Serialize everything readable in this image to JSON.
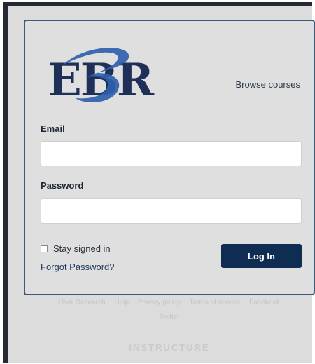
{
  "header": {
    "logo_text": "EBR",
    "browse_label": "Browse courses"
  },
  "form": {
    "email_label": "Email",
    "email_value": "",
    "password_label": "Password",
    "password_value": "",
    "stay_signed_label": "Stay signed in",
    "stay_signed_checked": false,
    "forgot_label": "Forgot Password?",
    "login_label": "Log In"
  },
  "footer": {
    "links": [
      "User Research",
      "Help",
      "Privacy policy",
      "Terms of service",
      "Facebook"
    ],
    "second_row": "Twitter",
    "brand": "INSTRUCTURE"
  },
  "colors": {
    "brand_navy": "#0f2d52",
    "logo_blue": "#2f5fab",
    "logo_dark": "#1e2f58",
    "card_border": "#3d5a7a"
  }
}
